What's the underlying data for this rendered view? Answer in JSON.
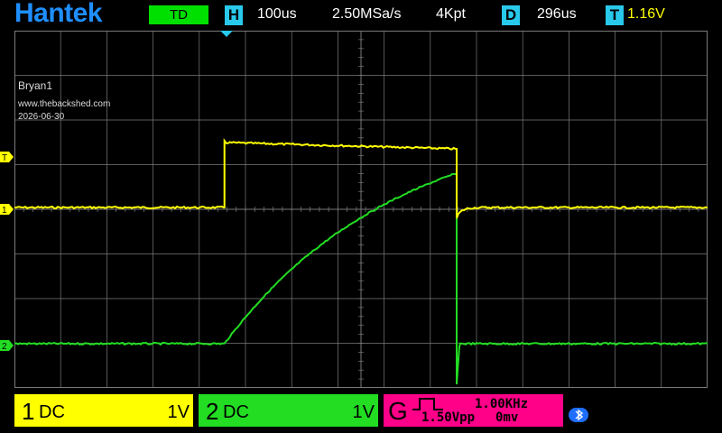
{
  "header": {
    "brand": "Hantek",
    "mode": "TD",
    "horizontal": {
      "letter": "H",
      "timebase": "100us",
      "sample_rate": "2.50MSa/s",
      "memory_depth": "4Kpt"
    },
    "delay": {
      "letter": "D",
      "value": "296us"
    },
    "trigger": {
      "letter": "T",
      "level": "1.16V"
    }
  },
  "annotations": {
    "line1": "Bryan1",
    "line2": "www.thebackshed.com",
    "line3": "2026-06-30"
  },
  "markers": {
    "trigger": "T",
    "ch1": "1",
    "ch2": "2"
  },
  "channels": [
    {
      "num": "1",
      "coupling": "DC",
      "scale": "1V",
      "color": "#ffff00"
    },
    {
      "num": "2",
      "coupling": "DC",
      "scale": "1V",
      "color": "#22dd22"
    }
  ],
  "generator": {
    "letter": "G",
    "frequency": "1.00KHz",
    "amplitude": "1.50Vpp",
    "offset": "0mv",
    "color": "#ff0088"
  },
  "colors": {
    "grid": "#7a7a7a",
    "brand": "#1e8fff",
    "badge": "#29c9ec",
    "mode": "#00e000"
  },
  "icons": {
    "bluetooth": "bluetooth-icon"
  },
  "waveforms": {
    "pulse_start": 0.303,
    "pulse_end": 0.638,
    "trigger_position": 0.303
  }
}
